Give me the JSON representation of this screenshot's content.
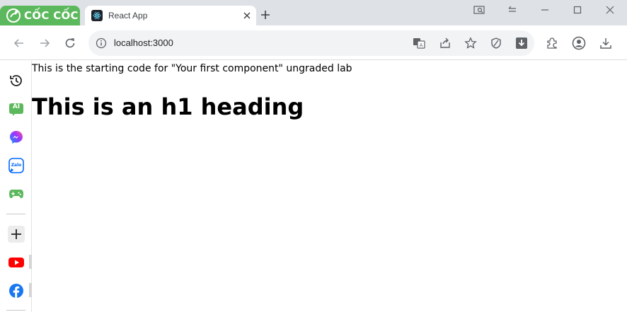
{
  "browser": {
    "brand_name": "CỐC CỐC",
    "tab": {
      "title": "React App"
    },
    "omnibox": {
      "url": "localhost:3000"
    }
  },
  "toolbar_icons": [
    "back-icon",
    "forward-icon",
    "reload-icon",
    "translate-icon",
    "share-icon",
    "star-icon",
    "shield-icon",
    "download-ext-icon",
    "extensions-icon",
    "profile-icon",
    "downloads-icon"
  ],
  "window_controls": [
    "search-tabs-icon",
    "back-history-icon",
    "minimize-icon",
    "maximize-icon",
    "close-icon"
  ],
  "sidebar": {
    "items": [
      "history-icon",
      "ai-icon",
      "messenger-icon",
      "zalo-icon",
      "games-icon",
      "add-icon",
      "youtube-icon",
      "facebook-icon"
    ],
    "ai_label": "AI",
    "zalo_label": "Zalo"
  },
  "page": {
    "paragraph": "This is the starting code for \"Your first component\" ungraded lab",
    "heading": "This is an h1 heading"
  },
  "colors": {
    "brand_green": "#5cb85c",
    "tabstrip": "#dee1e6",
    "youtube_red": "#ff0000",
    "facebook_blue": "#1877f2",
    "messenger_purple": "#a033ff",
    "zalo_blue": "#0068ff"
  }
}
